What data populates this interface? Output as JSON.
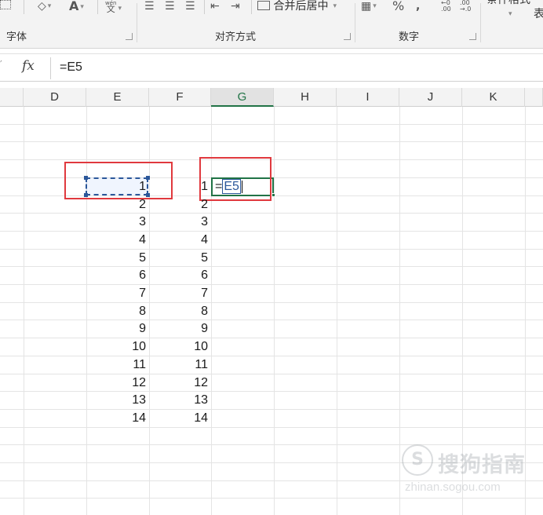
{
  "ribbon": {
    "font_size_glyph": "A",
    "wen_small": "wén",
    "wen_char": "文",
    "merge_center": "合并后居中",
    "percent": "%",
    "comma": ",",
    "inc_decimal_top": "←0",
    "inc_decimal_bottom": ".00",
    "dec_decimal_top": ".00",
    "dec_decimal_bottom": "→.0",
    "conditional_format": "条件格式",
    "table_partial": "表",
    "groups": {
      "font": "字体",
      "alignment": "对齐方式",
      "number": "数字"
    }
  },
  "formula_bar": {
    "fx_label": "fx",
    "value": "=E5"
  },
  "columns": [
    "D",
    "E",
    "F",
    "G",
    "H",
    "I",
    "J",
    "K"
  ],
  "active_column": "G",
  "column_e_values": [
    "1",
    "2",
    "3",
    "4",
    "5",
    "6",
    "7",
    "8",
    "9",
    "10",
    "11",
    "12",
    "13",
    "14"
  ],
  "column_f_values": [
    "1",
    "2",
    "3",
    "4",
    "5",
    "6",
    "7",
    "8",
    "9",
    "10",
    "11",
    "12",
    "13",
    "14"
  ],
  "edit_cell": {
    "equals": "=",
    "ref": "E5"
  },
  "watermark": {
    "logo_char": "S",
    "text": "搜狗指南",
    "url": "zhinan.sogou.com"
  },
  "colors": {
    "annotation_red": "#e0393e",
    "excel_green": "#217346",
    "reference_blue": "#2b579a"
  }
}
